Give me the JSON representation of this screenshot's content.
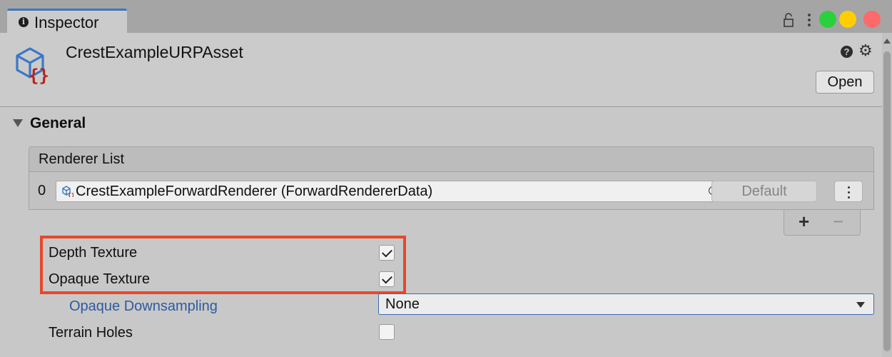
{
  "window": {
    "tab_label": "Inspector",
    "controls": {
      "close_color": "#fd6a6a",
      "minimize_color": "#ffcd00",
      "zoom_color": "#2ad13c"
    }
  },
  "header": {
    "asset_name": "CrestExampleURPAsset",
    "open_label": "Open",
    "help_icon": "?",
    "gear_icon": "⚙"
  },
  "section": {
    "title": "General",
    "renderer_list": {
      "label": "Renderer List",
      "rows": [
        {
          "index": "0",
          "value": "CrestExampleForwardRenderer (ForwardRendererData)",
          "default_label": "Default"
        }
      ],
      "add_label": "+",
      "remove_label": "−"
    },
    "properties": {
      "depth_texture": {
        "label": "Depth Texture",
        "checked": true
      },
      "opaque_texture": {
        "label": "Opaque Texture",
        "checked": true
      },
      "opaque_downsampling": {
        "label": "Opaque Downsampling",
        "value": "None"
      },
      "terrain_holes": {
        "label": "Terrain Holes",
        "checked": false
      }
    },
    "highlight_color": "#e8472a"
  }
}
